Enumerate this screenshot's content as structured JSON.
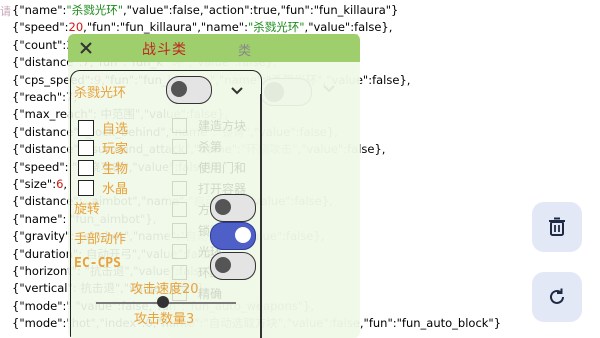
{
  "corner_label": "请",
  "log_lines": [
    {
      "indent": 1,
      "parts": [
        [
          "p",
          "{"
        ],
        [
          "k",
          "\"name\""
        ],
        [
          "p",
          ":"
        ],
        [
          "s",
          "\"杀戮光环\""
        ],
        [
          "p",
          ",\"value\":false,\"action\":true,\"fun\":\"fun_killaura\"}"
        ]
      ]
    },
    {
      "indent": 1,
      "parts": [
        [
          "p",
          "{"
        ],
        [
          "k",
          "\"speed\""
        ],
        [
          "p",
          ":"
        ],
        [
          "n",
          "20"
        ],
        [
          "p",
          ",\"fun\":\"fun_killaura\",\"name\":"
        ],
        [
          "s",
          "\"杀戮光环\""
        ],
        [
          "p",
          ",\"value\":false},"
        ]
      ]
    },
    {
      "indent": 1,
      "parts": [
        [
          "p",
          "{"
        ],
        [
          "k",
          "\"count\""
        ],
        [
          "p",
          ":3,\"fun\":\"fun_kil\"                                         \"value\":false},"
        ]
      ]
    },
    {
      "indent": 1,
      "parts": [
        [
          "p",
          "{"
        ],
        [
          "k",
          "\"distance\""
        ],
        [
          "p",
          ":7,\"fun\":\"fun_k\"                     环\",\"value\":false},"
        ]
      ]
    },
    {
      "indent": 1,
      "parts": [
        [
          "p",
          "{"
        ],
        [
          "k",
          "\"cps_speed\""
        ],
        [
          "p",
          ":"
        ],
        [
          "n",
          "9"
        ],
        [
          "p",
          ",\"fun\":\"fun_killaura\",\"name\":\"杀戮光环\",\"value\":false},"
        ]
      ]
    },
    {
      "indent": 1,
      "parts": [
        [
          "p",
          "{"
        ],
        [
          "k",
          "\"reach\""
        ],
        [
          "p",
          ":7,"
        ]
      ]
    },
    {
      "indent": 1,
      "parts": [
        [
          "p",
          "{"
        ],
        [
          "k",
          "\"max_reach\""
        ],
        [
          "p",
          ":                                  中范围\",\"value\":false},"
        ]
      ]
    },
    {
      "indent": 1,
      "parts": [
        [
          "p",
          "{"
        ],
        [
          "k",
          "\"distance\""
        ],
        [
          "p",
          ":                  _lock_behind\",\"name\":"
        ],
        [
          "s",
          "\"锁背\""
        ],
        [
          "p",
          ",\"value\":false},"
        ]
      ]
    },
    {
      "indent": 1,
      "parts": [
        [
          "p",
          "{"
        ],
        [
          "k",
          "\"distance\""
        ],
        [
          "p",
          ":                  _surround_attack\",\"name\":"
        ],
        [
          "s",
          "\"环绕攻击\""
        ],
        [
          "p",
          ",\"value\":false},"
        ]
      ]
    },
    {
      "indent": 1,
      "parts": [
        [
          "p",
          "{"
        ],
        [
          "k",
          "\"speed\""
        ],
        [
          "p",
          ":                               \"环绕攻击\",\"value\":false},"
        ]
      ]
    },
    {
      "indent": 1,
      "parts": [
        [
          "p",
          "{"
        ],
        [
          "k",
          "\"size\""
        ],
        [
          "p",
          ":"
        ],
        [
          "n",
          "6"
        ],
        [
          "p",
          ","
        ]
      ]
    },
    {
      "indent": 1,
      "parts": [
        [
          "p",
          "{"
        ],
        [
          "k",
          "\"distance\""
        ],
        [
          "p",
          ":                      _aimbot\",\"name\":"
        ],
        [
          "s",
          "\"自动瞄准\""
        ],
        [
          "p",
          ",\"value\":false},"
        ]
      ]
    },
    {
      "indent": 1,
      "parts": [
        [
          "p",
          "{"
        ],
        [
          "k",
          "\"name\""
        ],
        [
          "p",
          ":                            \"fun_aimbot\"},"
        ]
      ]
    },
    {
      "indent": 1,
      "parts": [
        [
          "p",
          "{"
        ],
        [
          "k",
          "\"gravity\""
        ],
        [
          "p",
          ":                        _aimbot\",\"name\":"
        ],
        [
          "s",
          "\"自动瞄准\""
        ],
        [
          "p",
          ",\"value\":false},"
        ]
      ]
    },
    {
      "indent": 1,
      "parts": [
        [
          "p",
          "{"
        ],
        [
          "k",
          "\"duration\""
        ],
        [
          "p",
          ":                       自动开弓\",\"value\":false},"
        ]
      ]
    },
    {
      "indent": 1,
      "parts": [
        [
          "p",
          "{"
        ],
        [
          "k",
          "\"horizont\""
        ],
        [
          "p",
          ":                         \"抗击退\",\"value\":false},"
        ]
      ]
    },
    {
      "indent": 1,
      "parts": [
        [
          "p",
          "{"
        ],
        [
          "k",
          "\"vertical\""
        ],
        [
          "p",
          ":                          抗击退\",\"value\":false},"
        ]
      ]
    },
    {
      "indent": 1,
      "parts": [
        [
          "p",
          "{"
        ],
        [
          "k",
          "\"mode\""
        ],
        [
          "p",
          ":\"                        \"value\":false,\"fun\":\"fun_auto_weapons\"},"
        ]
      ]
    },
    {
      "indent": 1,
      "parts": [
        [
          "p",
          "{"
        ],
        [
          "k",
          "\"mode\""
        ],
        [
          "p",
          ":\"hot\",\"index\":0,\"name\":\"自动选取方块\",\"value\":false,\"fun\":\"fun_auto_block\"}"
        ]
      ]
    }
  ],
  "panel": {
    "title": "战斗类",
    "header_right": "类",
    "module_name": "杀戮光环",
    "targets": [
      {
        "label": "自选",
        "checked": false
      },
      {
        "label": "玩家",
        "checked": false
      },
      {
        "label": "生物",
        "checked": false
      },
      {
        "label": "水晶",
        "checked": false
      }
    ],
    "rotate_label": "旋转",
    "hand_action_label": "手部动作",
    "ec_cps_label": "EC-CPS",
    "attack_speed_label": "攻击速度20",
    "attack_count_label": "攻击数量3",
    "module_toggle_on": false,
    "rotate_toggle_on": false,
    "hand_toggle_on": true,
    "ec_toggle_on": false,
    "slider_value": 0.48,
    "faded_items": [
      "建造方块",
      "杀第",
      "使用门和",
      "打开容器",
      "方块对",
      "锁背",
      "光环",
      "环绕攻",
      "精确"
    ]
  },
  "ghost_panel": {
    "title": "类",
    "toggle_on": false
  },
  "fabs": {
    "delete_icon": "trash-icon",
    "refresh_icon": "refresh-icon"
  },
  "colors": {
    "header_green": "#9fcf6d",
    "label_orange": "#e9a23c",
    "title_red": "#c0251f",
    "toggle_blue": "#4f5fc8",
    "string_green": "#1a8a1a",
    "number_red": "#d21414"
  }
}
